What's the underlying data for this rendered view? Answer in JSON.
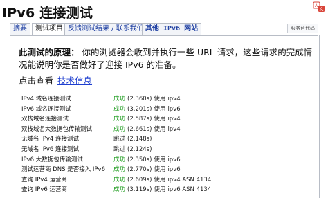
{
  "page_title": "IPv6 连接测试",
  "colors": {
    "success": "#1a9a1a",
    "link": "#1f3fcf",
    "tab_link": "#2242a3"
  },
  "tabs": [
    {
      "label": "摘要",
      "active": false
    },
    {
      "label": "测试项目",
      "active": true
    },
    {
      "label": "反馈测试结果 / 联系我们",
      "active": false
    },
    {
      "label": "其他 IPv6 网站",
      "active": false,
      "mono": true
    }
  ],
  "service_link_label": "服务台代码",
  "principle": {
    "heading": "此测试的原理：",
    "text": "你的浏览器会收到并执行一些 URL 请求，这些请求的完成情况能说明你是否做好了迎接 IPv6 的准备。"
  },
  "details": {
    "prompt": "点击查看",
    "link": "技术信息"
  },
  "results": [
    {
      "label": "IPv4 域名连接测试",
      "status": "成功",
      "ok": true,
      "time": "(2.360s)",
      "use": "使用",
      "value": "ipv4"
    },
    {
      "label": "IPv6 域名连接测试",
      "status": "成功",
      "ok": true,
      "time": "(3.201s)",
      "use": "使用",
      "value": "ipv6"
    },
    {
      "label": "双栈域名连接测试",
      "status": "成功",
      "ok": true,
      "time": "(2.587s)",
      "use": "使用",
      "value": "ipv4"
    },
    {
      "label": "双栈域名大数据包传输测试",
      "status": "成功",
      "ok": true,
      "time": "(2.661s)",
      "use": "使用",
      "value": "ipv4"
    },
    {
      "label": "无域名 IPv4 连接测试",
      "status": "跳过",
      "ok": false,
      "time": "(2.148s)",
      "use": "",
      "value": ""
    },
    {
      "label": "无域名 IPv6 连接测试",
      "status": "跳过",
      "ok": false,
      "time": "(2.124s)",
      "use": "",
      "value": ""
    },
    {
      "label": "IPv6 大数据包传输测试",
      "status": "成功",
      "ok": true,
      "time": "(2.350s)",
      "use": "使用",
      "value": "ipv6"
    },
    {
      "label": "测试运营商 DNS 是否接入 IPv6",
      "status": "成功",
      "ok": true,
      "time": "(2.770s)",
      "use": "使用",
      "value": "ipv6"
    },
    {
      "label": "查询 IPv4 运营商",
      "status": "成功",
      "ok": true,
      "time": "(2.609s)",
      "use": "使用",
      "value": "ipv4 ASN 4134"
    },
    {
      "label": "查询 IPv6 运营商",
      "status": "成功",
      "ok": true,
      "time": "(3.119s)",
      "use": "使用",
      "value": "ipv6 ASN 4134"
    }
  ]
}
